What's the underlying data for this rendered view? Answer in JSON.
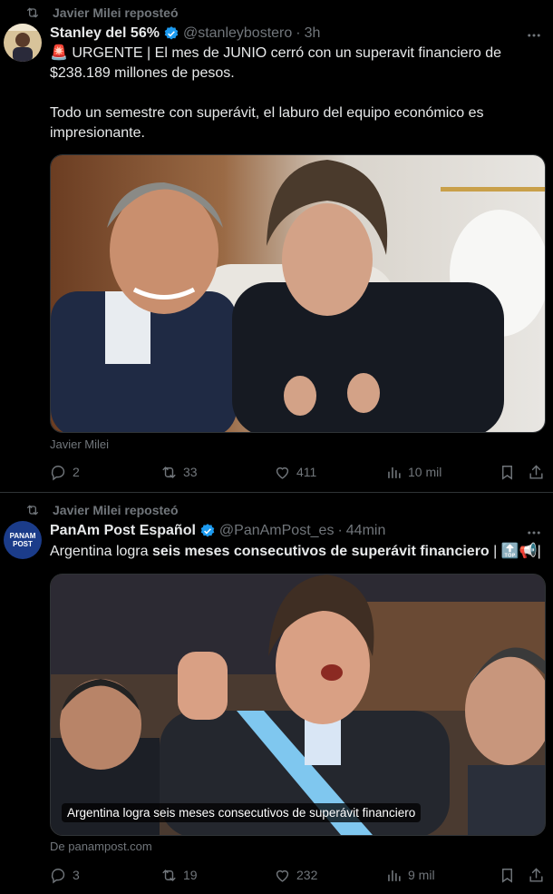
{
  "tweets": [
    {
      "repost_label": "Javier Milei reposteó",
      "author_name": "Stanley del 56%",
      "handle": "@stanleybostero",
      "time": "3h",
      "text_line1": "🚨 URGENTE | El mes de JUNIO cerró con un superavit financiero de",
      "text_line2": "$238.189 millones de pesos.",
      "text_line3": "Todo un semestre con superávit, el laburo del equipo económico es",
      "text_line4": "impresionante.",
      "source": "Javier Milei",
      "replies": "2",
      "reposts": "33",
      "likes": "411",
      "views": "10 mil"
    },
    {
      "repost_label": "Javier Milei reposteó",
      "author_name": "PanAm Post Español",
      "handle": "@PanAmPost_es",
      "time": "44min",
      "text_prefix": "Argentina logra ",
      "text_bold": "seis meses consecutivos de superávit financiero",
      "text_suffix": " | 🔝📢|",
      "media_caption": "Argentina logra seis meses consecutivos de superávit financiero",
      "source": "De panampost.com",
      "replies": "3",
      "reposts": "19",
      "likes": "232",
      "views": "9 mil",
      "avatar_text_top": "PANAM",
      "avatar_text_bottom": "POST"
    }
  ],
  "colors": {
    "background": "#000000",
    "text": "#e7e9ea",
    "muted": "#71767b",
    "verified": "#1d9bf0",
    "border": "#2f3336"
  },
  "icons": [
    "repost-icon",
    "verified-icon",
    "more-icon",
    "reply-icon",
    "retweet-icon",
    "like-icon",
    "views-icon",
    "bookmark-icon",
    "share-icon"
  ]
}
